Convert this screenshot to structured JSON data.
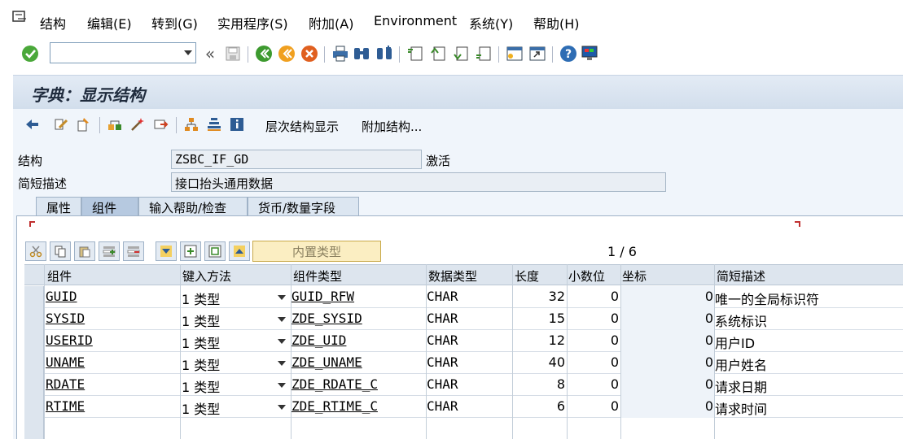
{
  "menubar": {
    "items": [
      "结构",
      "编辑(E)",
      "转到(G)",
      "实用程序(S)",
      "附加(A)",
      "Environment",
      "系统(Y)",
      "帮助(H)"
    ]
  },
  "toolbar": {
    "command_value": "",
    "icons": [
      "enter-icon",
      "back-double-icon",
      "save-icon",
      "back-icon",
      "exit-icon",
      "cancel-icon",
      "print-icon",
      "find-icon",
      "find-next-icon",
      "first-page-icon",
      "prev-page-icon",
      "next-page-icon",
      "last-page-icon",
      "new-session-icon",
      "shortcut-icon",
      "help-icon",
      "customize-layout-icon"
    ]
  },
  "title": "字典：显示结构",
  "app_toolbar": {
    "hierarchy_label": "层次结构显示",
    "append_label": "附加结构..."
  },
  "header": {
    "structure_label": "结构",
    "structure_value": "ZSBC_IF_GD",
    "status": "激活",
    "desc_label": "简短描述",
    "desc_value": "接口抬头通用数据"
  },
  "tabs": [
    "属性",
    "组件",
    "输入帮助/检查",
    "货币/数量字段"
  ],
  "active_tab": "组件",
  "table_toolbar": {
    "builtin_type_label": "内置类型",
    "pager": "1 / 6"
  },
  "table": {
    "columns": [
      "组件",
      "键入方法",
      "组件类型",
      "数据类型",
      "长度",
      "小数位",
      "坐标",
      "简短描述"
    ],
    "rows": [
      {
        "component": "GUID",
        "typing": "1 类型",
        "comp_type": "GUID_RFW",
        "data_type": "CHAR",
        "length": "32",
        "decimals": "0",
        "coord": "0",
        "desc": "唯一的全局标识符"
      },
      {
        "component": "SYSID",
        "typing": "1 类型",
        "comp_type": "ZDE_SYSID",
        "data_type": "CHAR",
        "length": "15",
        "decimals": "0",
        "coord": "0",
        "desc": "系统标识"
      },
      {
        "component": "USERID",
        "typing": "1 类型",
        "comp_type": "ZDE_UID",
        "data_type": "CHAR",
        "length": "12",
        "decimals": "0",
        "coord": "0",
        "desc": "用户ID"
      },
      {
        "component": "UNAME",
        "typing": "1 类型",
        "comp_type": "ZDE_UNAME",
        "data_type": "CHAR",
        "length": "40",
        "decimals": "0",
        "coord": "0",
        "desc": "用户姓名"
      },
      {
        "component": "RDATE",
        "typing": "1 类型",
        "comp_type": "ZDE_RDATE_C",
        "data_type": "CHAR",
        "length": "8",
        "decimals": "0",
        "coord": "0",
        "desc": "请求日期"
      },
      {
        "component": "RTIME",
        "typing": "1 类型",
        "comp_type": "ZDE_RTIME_C",
        "data_type": "CHAR",
        "length": "6",
        "decimals": "0",
        "coord": "0",
        "desc": "请求时间"
      }
    ]
  }
}
